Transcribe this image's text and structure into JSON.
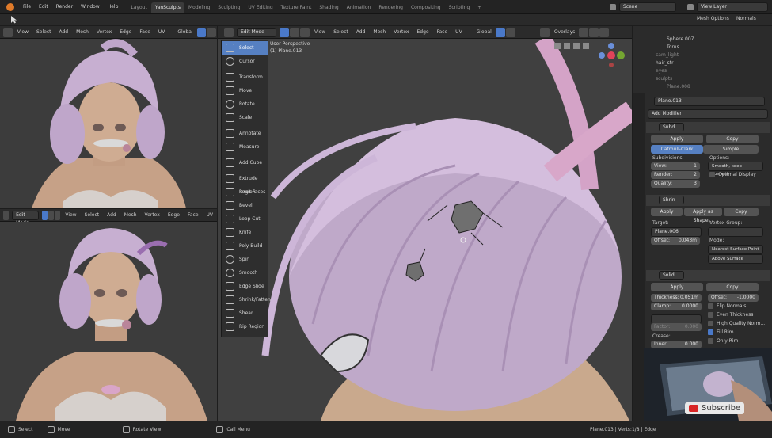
{
  "topbar": {
    "menus": [
      "File",
      "Edit",
      "Render",
      "Window",
      "Help"
    ],
    "workspaces": [
      "Layout",
      "YanSculpts",
      "Modeling",
      "Sculpting",
      "UV Editing",
      "Texture Paint",
      "Shading",
      "Animation",
      "Rendering",
      "Compositing",
      "Scripting"
    ],
    "active_workspace": "YanSculpts",
    "add_tab": "+",
    "scene": "Scene",
    "view_layer": "View Layer"
  },
  "subheader": {
    "mesh_options": "Mesh Options",
    "normals": "Normals"
  },
  "left_top_header": {
    "menus": [
      "View",
      "Select",
      "Add",
      "Mesh",
      "Vertex",
      "Edge",
      "Face",
      "UV"
    ],
    "orientation": "Global"
  },
  "left_bottom_header": {
    "mode": "Edit Mode",
    "menus": [
      "View",
      "Select",
      "Add",
      "Mesh",
      "Vertex",
      "Edge",
      "Face",
      "UV"
    ]
  },
  "main_header": {
    "mode": "Edit Mode",
    "menus": [
      "View",
      "Select",
      "Add",
      "Mesh",
      "Vertex",
      "Edge",
      "Face",
      "UV"
    ],
    "orientation": "Global",
    "overlays": "Overlays"
  },
  "viewport_info": {
    "perspective": "User Perspective",
    "object": "(1) Plane.013"
  },
  "tools": [
    "Select",
    "Cursor",
    "Transform",
    "Move",
    "Rotate",
    "Scale",
    "Annotate",
    "Measure",
    "Add Cube",
    "Extrude Region",
    "Inset Faces",
    "Bevel",
    "Loop Cut",
    "Knife",
    "Poly Build",
    "Spin",
    "Smooth",
    "Edge Slide",
    "Shrink/Fatten",
    "Shear",
    "Rip Region"
  ],
  "outliner": {
    "rows": [
      {
        "name": "Sphere.007",
        "dim": false
      },
      {
        "name": "Torus",
        "dim": false
      },
      {
        "name": "cam_light",
        "dim": true
      },
      {
        "name": "hair_str",
        "dim": false
      },
      {
        "name": "eyes",
        "dim": true
      },
      {
        "name": "sculpts",
        "dim": true
      },
      {
        "name": "Plane.008",
        "dim": true
      }
    ]
  },
  "properties": {
    "object_name": "Plane.013",
    "add_modifier": "Add Modifier",
    "subd": {
      "name": "Subd",
      "apply": "Apply",
      "copy": "Copy",
      "type_catmull": "Catmull-Clark",
      "type_simple": "Simple",
      "subdivisions_label": "Subdivisions:",
      "view_label": "View:",
      "view_value": "1",
      "render_label": "Render:",
      "render_value": "2",
      "quality_label": "Quality:",
      "quality_value": "3",
      "options_label": "Options:",
      "uv_smooth": "Smooth, keep corners",
      "optimal_display": "Optimal Display"
    },
    "shrink": {
      "name": "Shrin",
      "apply": "Apply",
      "apply_shape": "Apply as Shape...",
      "copy": "Copy",
      "target_label": "Target:",
      "target_value": "Plane.006",
      "vertex_group_label": "Vertex Group:",
      "offset_label": "Offset:",
      "offset_value": "0.043m",
      "mode_label": "Mode:",
      "mode_value": "Nearest Surface Point",
      "above_surface": "Above Surface"
    },
    "solid": {
      "name": "Solid",
      "apply": "Apply",
      "copy": "Copy",
      "thickness_label": "Thickness:",
      "thickness_value": "0.051m",
      "offset_label": "Offset:",
      "offset_value": "-1.0000",
      "clamp_label": "Clamp:",
      "clamp_value": "0.0000",
      "factor_label": "Factor:",
      "factor_value": "0.000",
      "crease_label": "Crease:",
      "inner_label": "Inner:",
      "inner_value": "0.000",
      "flip_normals": "Flip Normals",
      "even_thickness": "Even Thickness",
      "high_quality": "High Quality Norm...",
      "fill_rim": "Fill Rim",
      "only_rim": "Only Rim"
    }
  },
  "subscribe": "Subscribe",
  "status": {
    "select": "Select",
    "move": "Move",
    "rotate_view": "Rotate View",
    "call_menu": "Call Menu",
    "stats": "Plane.013 | Verts:1/8 | Edge"
  },
  "colors": {
    "accent": "#5680c2",
    "hair": "#c9b2d3",
    "skin": "#c8a58a",
    "viewport": "#3f3f3f"
  }
}
